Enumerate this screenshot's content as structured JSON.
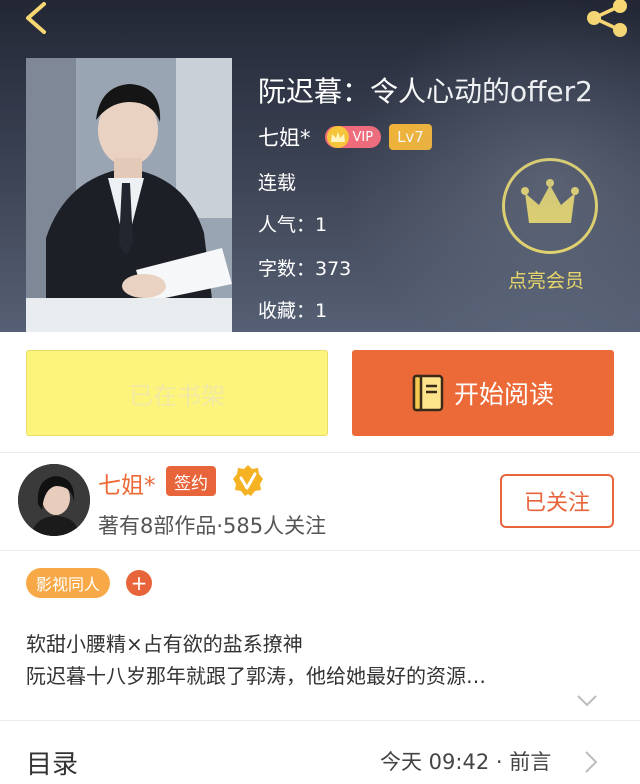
{
  "book": {
    "title": "阮迟暮：令人心动的offer2",
    "author": "七姐*",
    "vip_label": "VIP",
    "level_label": "Lv7",
    "status": "连载",
    "popularity": "人气：1",
    "word_count": "字数：373",
    "favorites": "收藏：1"
  },
  "member": {
    "label": "点亮会员"
  },
  "actions": {
    "shelf_label": "已在书架",
    "read_label": "开始阅读"
  },
  "author_block": {
    "name": "七姐*",
    "sign_label": "签约",
    "stats": "著有8部作品·585人关注",
    "follow_label": "已关注"
  },
  "tags": [
    {
      "label": "影视同人"
    }
  ],
  "add_tag_symbol": "+",
  "description": [
    "软甜小腰精×占有欲的盐系撩神",
    "阮迟暮十八岁那年就跟了郭涛，他给她最好的资源…"
  ],
  "toc": {
    "label": "目录",
    "latest": "今天 09:42 · 前言"
  },
  "colors": {
    "accent": "#ec6a37",
    "shelf_button": "#fdf57b",
    "member_gold": "#f7e25f",
    "level_badge": "#f6b531",
    "genre_tag": "#f7a947"
  },
  "icons": [
    "back-arrow-icon",
    "share-icon",
    "crown-icon",
    "book-icon",
    "verified-icon",
    "chevron-down-icon",
    "chevron-right-icon"
  ]
}
